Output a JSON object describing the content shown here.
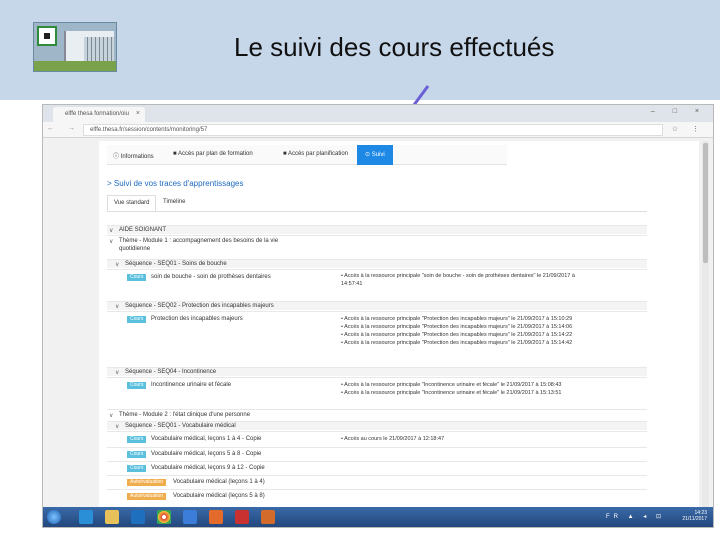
{
  "slide": {
    "title": "Le suivi des cours effectués"
  },
  "browser": {
    "tab_title": "elffe thesa formation/oiu",
    "tab_close": "×",
    "window_controls": "– □ ×",
    "nav_buttons": "← → C",
    "url": "elffe.thesa.fr/session/contents/monitoring/57",
    "addr_right": "☆ ⋮"
  },
  "navbar": {
    "items": [
      {
        "label": "ⓘ Informations",
        "active": false
      },
      {
        "label": "■ Accès par plan de formation",
        "active": false
      },
      {
        "label": "■ Accès par planification",
        "active": false
      },
      {
        "label": "⊙ Suivi",
        "active": true
      }
    ]
  },
  "breadcrumb": "> Suivi de vos traces d'apprentissages",
  "subtabs": [
    "Vue standard",
    "Timeline"
  ],
  "tree": {
    "root": "AIDE SOIGNANT",
    "theme1_line1": "Thème - Module 1 : accompagnement des besoins de la vie",
    "theme1_line2": "quotidienne",
    "seq1": "Séquence - SEQ01 - Soins de bouche",
    "seq1_badge": "Cours",
    "seq1_item": "soin de bouche - soin de prothèses dentaires",
    "seq1_logs": [
      "• Accès à la ressource principale \"soin de bouche - soin de prothèses dentaires\" le 21/09/2017 à",
      "  14:57:41"
    ],
    "seq2": "Séquence - SEQ02 - Protection des incapables majeurs",
    "seq2_badge": "Cours",
    "seq2_item": "Protection des incapables majeurs",
    "seq2_logs": [
      "• Accès à la ressource principale \"Protection des incapables majeurs\" le 21/09/2017 à 15:10:29",
      "• Accès à la ressource principale \"Protection des incapables majeurs\" le 21/09/2017 à 15:14:06",
      "• Accès à la ressource principale \"Protection des incapables majeurs\" le 21/09/2017 à 15:14:22",
      "• Accès à la ressource principale \"Protection des incapables majeurs\" le 21/09/2017 à 15:14:42"
    ],
    "seq4": "Séquence - SEQ04 - Incontinence",
    "seq4_badge": "Cours",
    "seq4_item": "Incontinence urinaire et fécale",
    "seq4_logs": [
      "• Accès à la ressource principale \"Incontinence urinaire et fécale\" le 21/09/2017 à 15:08:43",
      "• Accès à la ressource principale \"Incontinence urinaire et fécale\" le 21/09/2017 à 15:13:51"
    ],
    "theme2": "Thème - Module 2 : l'état clinique d'une personne",
    "seq5": "Séquence - SEQ01 - Vocabulaire médical",
    "seq5_items": [
      {
        "badge": "Cours",
        "label": "Vocabulaire médical, leçons 1 à 4 - Copie",
        "orange": false
      },
      {
        "badge": "Cours",
        "label": "Vocabulaire médical, leçons 5 à 8 - Copie",
        "orange": false
      },
      {
        "badge": "Cours",
        "label": "Vocabulaire médical, leçons 9 à 12 - Copie",
        "orange": false
      },
      {
        "badge": "Autoévaluation",
        "label": "Vocabulaire médical (leçons 1 à 4)",
        "orange": true
      },
      {
        "badge": "Autoévaluation",
        "label": "Vocabulaire médical (leçons 5 à 8)",
        "orange": true
      }
    ],
    "seq5_log": "• Accès au cours le 21/09/2017 à 12:18:47"
  },
  "taskbar": {
    "tray": "FR ▲ ◂ ⊡",
    "time": "14:23",
    "date": "21/11/2017"
  },
  "colors": {
    "header_band": "#c7d7ea",
    "active_tab": "#1e88e5",
    "badge_blue": "#5bc0de",
    "badge_orange": "#f0ad4e",
    "arrow": "#6b5fd6"
  }
}
